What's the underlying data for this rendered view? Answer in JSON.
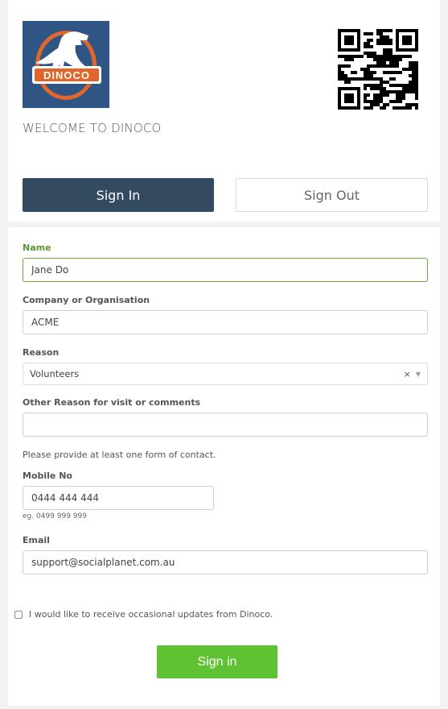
{
  "header": {
    "logo_text": "DINOCO",
    "welcome": "WELCOME TO DINOCO",
    "colors": {
      "logo_bg": "#2f5585",
      "logo_orange": "#e0662b"
    }
  },
  "tabs": [
    {
      "label": "Sign In",
      "active": true
    },
    {
      "label": "Sign Out",
      "active": false
    }
  ],
  "form": {
    "name": {
      "label": "Name",
      "value": "Jane Do"
    },
    "company": {
      "label": "Company or Organisation",
      "value": "ACME"
    },
    "reason": {
      "label": "Reason",
      "value": "Volunteers",
      "clear": "×",
      "arrow": "▼"
    },
    "other": {
      "label": "Other Reason for visit or comments",
      "value": ""
    },
    "contact_note": "Please provide at least one form of contact.",
    "mobile": {
      "label": "Mobile No",
      "value": "0444 444 444",
      "hint": "eg. 0499 999 999"
    },
    "email": {
      "label": "Email",
      "value": "support@socialplanet.com.au"
    },
    "updates_label": "I would like to receive occasional updates from Dinoco.",
    "updates_checked": false,
    "submit_label": "Sign in"
  },
  "colors": {
    "primary": "#334a61",
    "success": "#5ec232",
    "focus": "#6aac3a",
    "label_focus": "#5d9531"
  }
}
